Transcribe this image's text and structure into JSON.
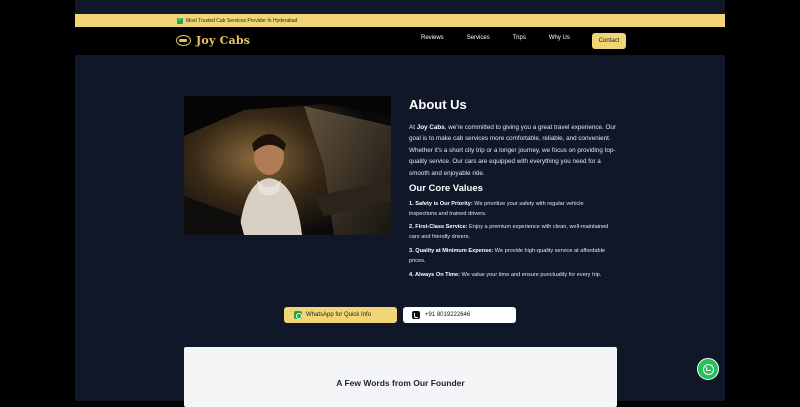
{
  "topbar": {
    "text": "Most Trusted Cab Services Provider In Hyderabad"
  },
  "brand": {
    "name": "Joy Cabs"
  },
  "nav": {
    "links": [
      "Reviews",
      "Services",
      "Trips",
      "Why Us"
    ],
    "contact": "Contact"
  },
  "about": {
    "title": "About Us",
    "lead_brand": "Joy Cabs",
    "text": ", we're committed to giving you a great travel experience. Our goal is to make cab services more comfortable, reliable, and convenient. Whether it's a short city trip or a longer journey, we focus on providing top-quality service. Our cars are equipped with everything you need for a smooth and enjoyable ride.",
    "lead_prefix": "At "
  },
  "core_values": {
    "title": "Our Core Values",
    "items": [
      {
        "label": "1. Safety is Our Priority:",
        "text": " We prioritize your safety with regular vehicle inspections and trained drivers."
      },
      {
        "label": "2. First-Class Service:",
        "text": " Enjoy a premium experience with clean, well-maintained cars and friendly drivers."
      },
      {
        "label": "3. Quality at Minimum Expense:",
        "text": " We provide high-quality service at affordable prices."
      },
      {
        "label": "4. Always On Time:",
        "text": " We value your time and ensure punctuality for every trip."
      }
    ]
  },
  "cta": {
    "whatsapp": "WhatsApp for Quick Info",
    "phone": "+91 8019222646"
  },
  "founder": {
    "title": "A Few Words from Our Founder"
  },
  "colors": {
    "accent": "#f2d675",
    "brand": "#e7c55e",
    "background": "#0f1729",
    "whatsapp": "#25c05a"
  },
  "icons": {
    "badge": "check-icon",
    "logo": "car-logo-icon",
    "whatsapp": "whatsapp-icon",
    "phone": "phone-icon"
  }
}
